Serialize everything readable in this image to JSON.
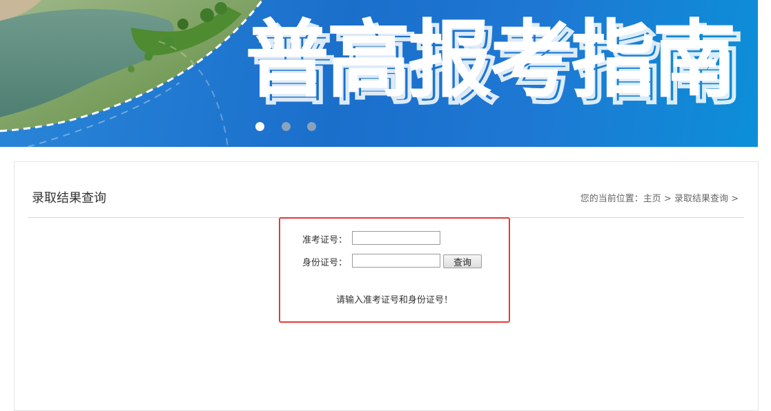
{
  "banner": {
    "title": "普高报考指南",
    "slides": [
      {
        "active": true
      },
      {
        "active": false
      },
      {
        "active": false
      }
    ]
  },
  "page": {
    "title": "录取结果查询"
  },
  "breadcrumb": {
    "prefix": "您的当前位置：",
    "home": "主页",
    "separator": ">",
    "current": "录取结果查询",
    "trailing": ">"
  },
  "form": {
    "exam_id_label": "准考证号：",
    "exam_id_value": "",
    "id_card_label": "身份证号：",
    "id_card_value": "",
    "query_button": "查询",
    "hint": "请输入准考证号和身份证号！"
  },
  "colors": {
    "banner_blue": "#1a6fcb",
    "highlight_border": "#e53935"
  }
}
